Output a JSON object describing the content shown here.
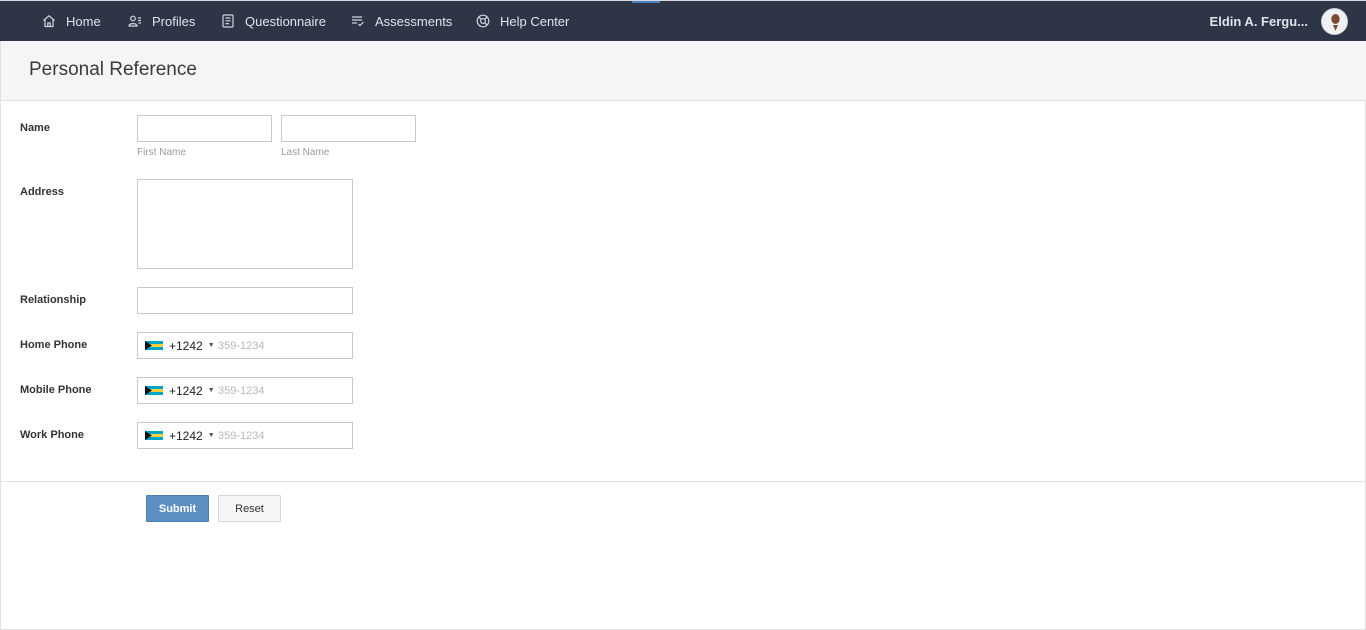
{
  "nav": {
    "items": [
      {
        "label": "Home",
        "icon": "home-icon"
      },
      {
        "label": "Profiles",
        "icon": "profiles-icon"
      },
      {
        "label": "Questionnaire",
        "icon": "questionnaire-icon"
      },
      {
        "label": "Assessments",
        "icon": "assessments-icon"
      },
      {
        "label": "Help Center",
        "icon": "help-center-icon"
      }
    ],
    "user_name": "Eldin A. Fergu..."
  },
  "page": {
    "title": "Personal Reference"
  },
  "form": {
    "name_label": "Name",
    "first_name_hint": "First Name",
    "last_name_hint": "Last Name",
    "first_name_value": "",
    "last_name_value": "",
    "address_label": "Address",
    "address_value": "",
    "relationship_label": "Relationship",
    "relationship_value": "",
    "home_phone_label": "Home Phone",
    "mobile_phone_label": "Mobile Phone",
    "work_phone_label": "Work Phone",
    "phone_country_code": "+1242",
    "phone_placeholder": "359-1234",
    "flag": "bahamas-flag-icon"
  },
  "actions": {
    "submit_label": "Submit",
    "reset_label": "Reset"
  },
  "colors": {
    "nav_background": "#2e3546",
    "submit_background": "#5b8ec2"
  }
}
